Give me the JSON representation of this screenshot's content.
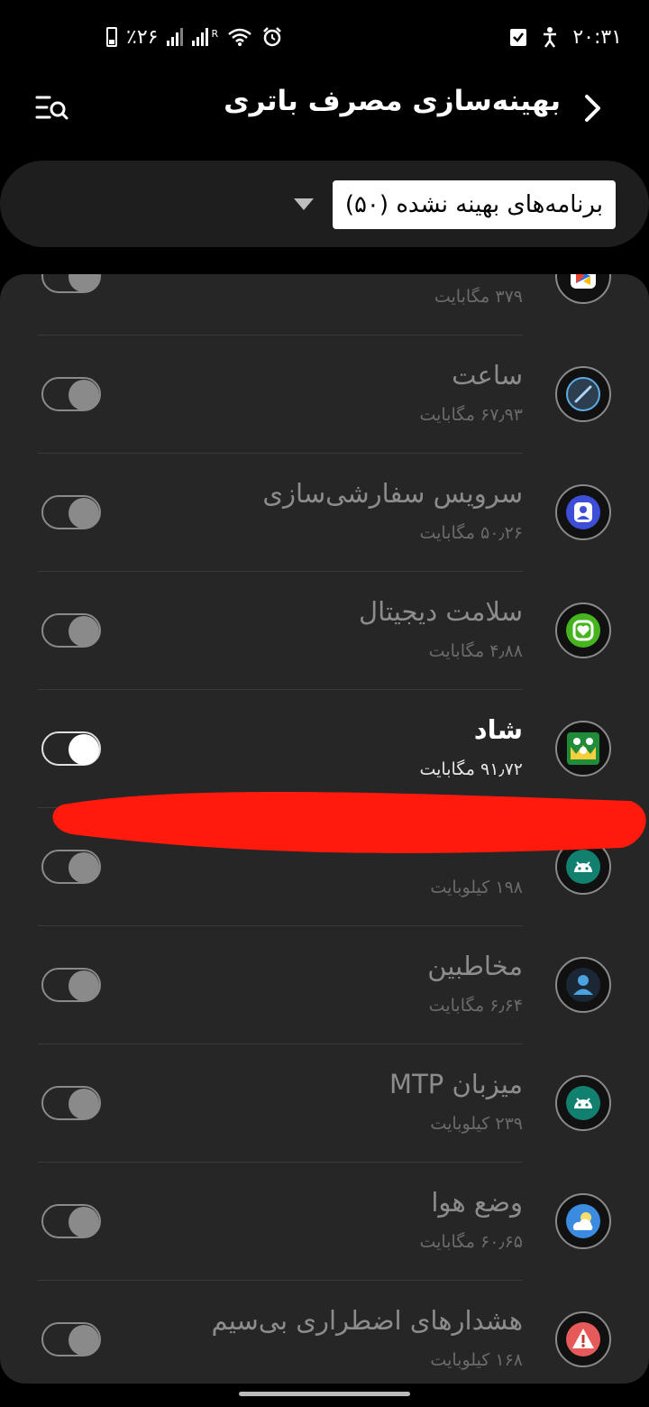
{
  "status_bar": {
    "time": "۲۰:۳۱",
    "battery_percent": "٪۲۶",
    "network_labels": "R"
  },
  "header": {
    "title": "بهینه‌سازی مصرف باتری"
  },
  "filter": {
    "selected": "برنامه‌های بهینه نشده (۵۰)"
  },
  "apps": [
    {
      "name": "",
      "size": "۳۷۹ مگابایت",
      "icon": "google-play-games-icon",
      "enabled": false
    },
    {
      "name": "ساعت",
      "size": "۶۷٫۹۳ مگابایت",
      "icon": "clock-icon",
      "enabled": false
    },
    {
      "name": "سرویس سفارشی‌سازی",
      "size": "۵۰٫۲۶ مگابایت",
      "icon": "customization-service-icon",
      "enabled": false
    },
    {
      "name": "سلامت دیجیتال",
      "size": "۴٫۸۸ مگابایت",
      "icon": "digital-wellbeing-icon",
      "enabled": false
    },
    {
      "name": "شاد",
      "size": "۹۱٫۷۲ مگابایت",
      "icon": "shad-app-icon",
      "enabled": true
    },
    {
      "name": "",
      "size": "۱۹۸ کیلوبایت",
      "icon": "android-icon",
      "enabled": false
    },
    {
      "name": "مخاطبین",
      "size": "۶٫۶۴ مگابایت",
      "icon": "contacts-icon",
      "enabled": false
    },
    {
      "name": "میزبان MTP",
      "size": "۲۳۹ کیلوبایت",
      "icon": "android-icon",
      "enabled": false
    },
    {
      "name": "وضع هوا",
      "size": "۶۰٫۶۵ مگابایت",
      "icon": "weather-icon",
      "enabled": false
    },
    {
      "name": "هشدارهای اضطراری بی‌سیم",
      "size": "۱۶۸ کیلوبایت",
      "icon": "emergency-alert-icon",
      "enabled": false
    }
  ],
  "colors": {
    "background": "#000000",
    "card": "#262626",
    "redaction": "#ff1a0d"
  }
}
